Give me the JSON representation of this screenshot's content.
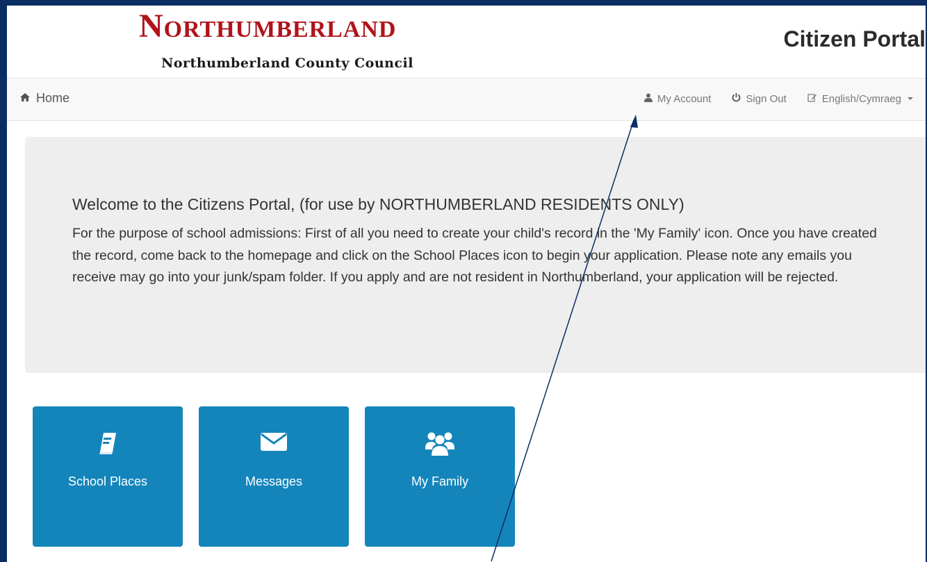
{
  "header": {
    "logo_text": "Northumberland",
    "logo_subtitle": "Northumberland County Council",
    "portal_title": "Citizen Portal"
  },
  "nav": {
    "home_icon": "home-icon",
    "home_label": "Home",
    "my_account_icon": "user-icon",
    "my_account_label": "My Account",
    "sign_out_icon": "power-icon",
    "sign_out_label": "Sign Out",
    "language_icon": "edit-icon",
    "language_label": "English/Cymraeg"
  },
  "jumbotron": {
    "welcome": "Welcome to the Citizens Portal, (for use by NORTHUMBERLAND RESIDENTS ONLY)",
    "intro": "For the purpose of school admissions: First of all you need to create your child's record in the 'My Family' icon. Once you have created the record, come back to the homepage and click on the School Places icon to begin your application. Please note any emails you receive may go into your junk/spam folder. If you apply and are not resident in Northumberland, your application will be rejected."
  },
  "tiles": [
    {
      "label": "School Places",
      "icon": "book-icon"
    },
    {
      "label": "Messages",
      "icon": "envelope-icon"
    },
    {
      "label": "My Family",
      "icon": "users-icon"
    }
  ],
  "colors": {
    "frame": "#0b2d63",
    "logo_red": "#b0131a",
    "tile_blue": "#1485bb",
    "jumbotron_bg": "#eeeeee",
    "navbar_bg": "#f8f8f8"
  }
}
